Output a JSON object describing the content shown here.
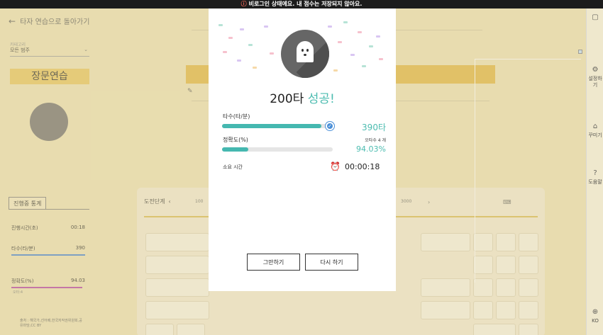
{
  "top_notice": {
    "icon": "warning-circle-icon",
    "text": "비로그인 상태에요. 내 점수는 저장되지 않아요."
  },
  "background": {
    "back_label": "타자 연습으로 돌아가기",
    "filter_label": "카테고리",
    "filter_value": "모든 범주",
    "mode_title": "장문연습",
    "stats_tab": "진행중 통계",
    "stats": [
      {
        "label": "진행시간(초)",
        "value": "00:18"
      },
      {
        "label": "타수(타/분)",
        "value": "390"
      },
      {
        "label": "정확도(%)",
        "value": "94.03",
        "sub": "오타:4"
      }
    ],
    "credit": "출처 : 해국가,선어배,한국저작권위원회,공유마당,CC BY",
    "keyboard_level": "도전단계",
    "keyboard_nums": [
      "100",
      "3000"
    ],
    "right_rail": [
      "설정하기",
      "꾸미기",
      "도움말",
      "KO"
    ]
  },
  "modal": {
    "result_speed": "200타",
    "result_status": "성공!",
    "speed_label": "타수(타/분)",
    "speed_value": "390타",
    "speed_fraction": 0.9,
    "accuracy_label": "정확도(%)",
    "typo_note": "오타수 4 개",
    "accuracy_value": "94.03%",
    "accuracy_fraction": 0.24,
    "time_label": "소요 시간",
    "time_value": "00:00:18",
    "stop_button": "그만하기",
    "retry_button": "다시 하기"
  },
  "colors": {
    "accent": "#4cbcb0",
    "background": "#eee2b4",
    "banner": "#e2b43c"
  }
}
